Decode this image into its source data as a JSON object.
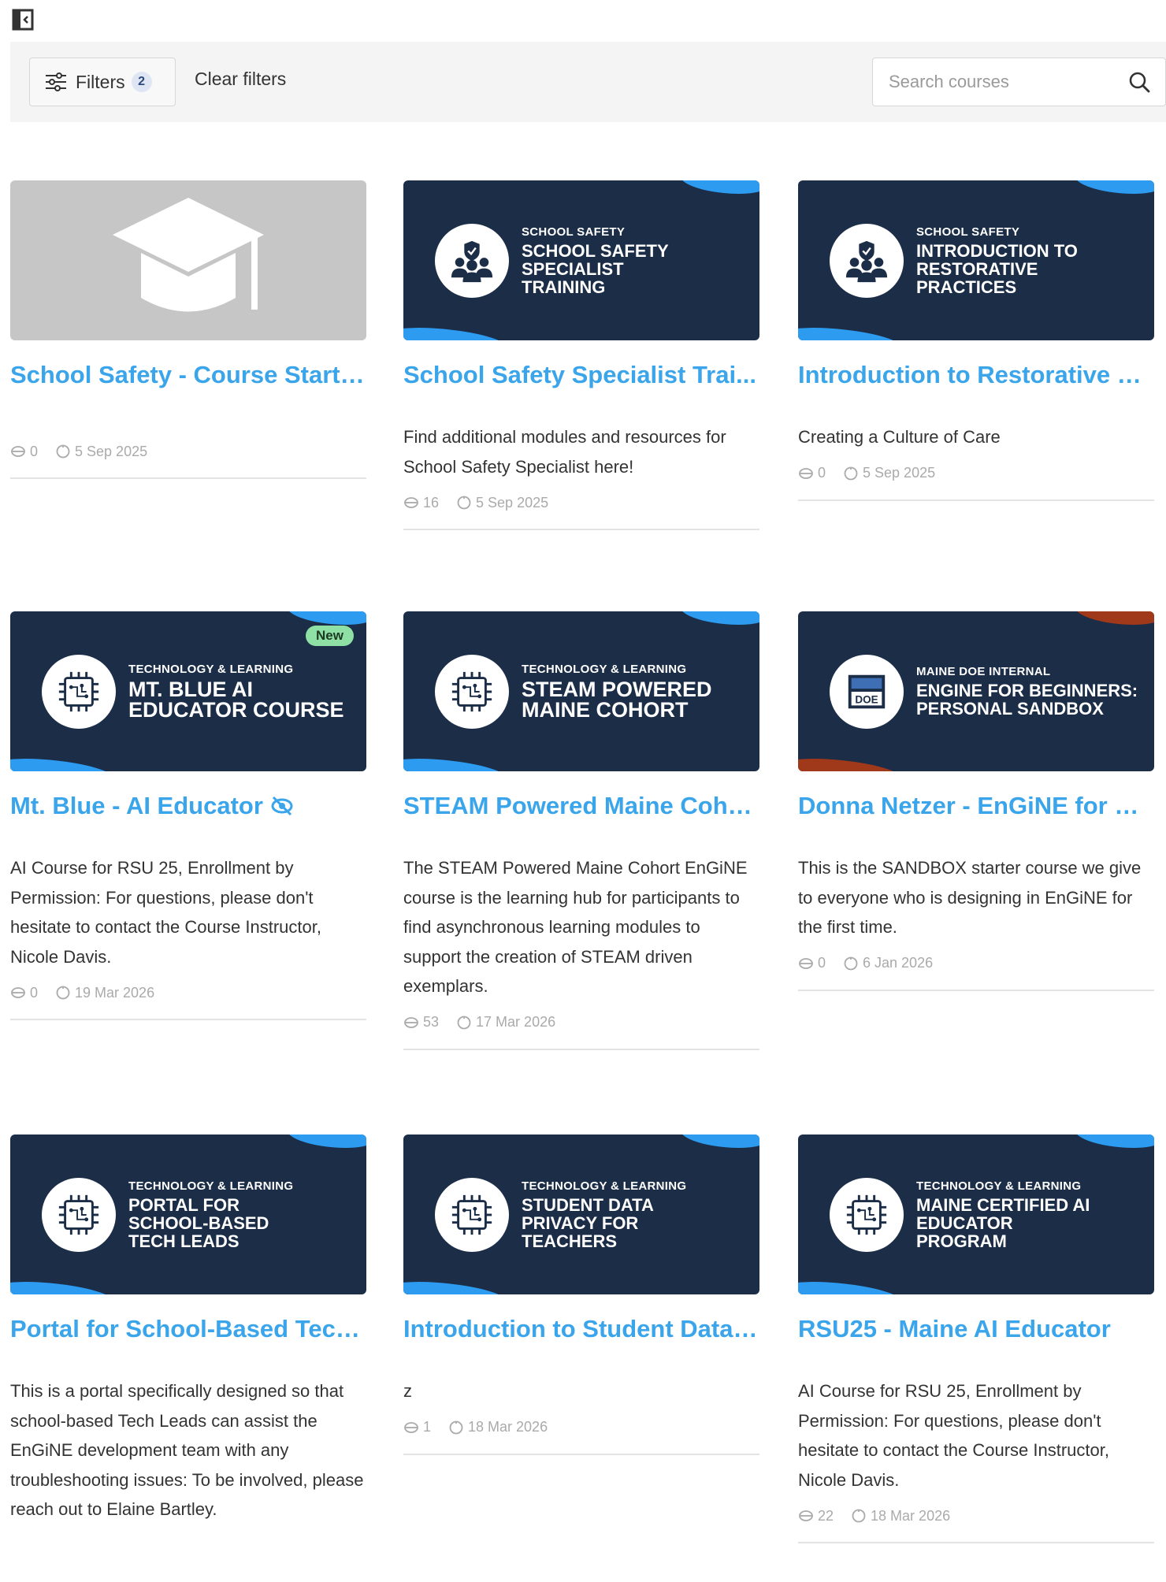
{
  "toolbar": {
    "filters_label": "Filters",
    "filters_count": "2",
    "clear_filters": "Clear filters",
    "search_placeholder": "Search courses"
  },
  "colors": {
    "accent": "#3aa5ea",
    "thumb_bg": "#1b2d47",
    "wave_blue": "#2d9bf0",
    "wave_rust": "#a0391a",
    "new_badge": "#8fe0a4"
  },
  "courses": [
    {
      "title": "School Safety - Course Starte...",
      "description": "",
      "enrolled": "0",
      "date": "5 Sep 2025",
      "thumb": {
        "type": "placeholder",
        "icon": "graduation-cap-icon"
      }
    },
    {
      "title": "School Safety Specialist Trai...",
      "description": "Find additional modules and resources for School Safety Specialist here!",
      "enrolled": "16",
      "date": "5 Sep 2025",
      "thumb": {
        "type": "banner",
        "category": "SCHOOL SAFETY",
        "heading": "SCHOOL SAFETY\nSPECIALIST\nTRAINING",
        "icon": "people-shield-icon"
      }
    },
    {
      "title": "Introduction to Restorative Pr...",
      "description": "Creating a Culture of Care",
      "enrolled": "0",
      "date": "5 Sep 2025",
      "thumb": {
        "type": "banner",
        "category": "SCHOOL SAFETY",
        "heading": "INTRODUCTION TO\nRESTORATIVE\nPRACTICES",
        "icon": "people-shield-icon"
      }
    },
    {
      "title": "Mt. Blue - AI Educator",
      "description": "AI Course for RSU 25, Enrollment by Permission: For questions, please don't hesitate to contact the Course Instructor, Nicole Davis.",
      "enrolled": "0",
      "date": "19 Mar 2026",
      "hidden": true,
      "badge": "New",
      "thumb": {
        "type": "banner",
        "category": "TECHNOLOGY & LEARNING",
        "heading": "MT. BLUE AI\nEDUCATOR COURSE",
        "icon": "chip-icon"
      }
    },
    {
      "title": "STEAM Powered Maine Cohort",
      "description": "The STEAM Powered Maine Cohort EnGiNE course is the learning hub for participants to find asynchronous learning modules to support the creation of STEAM driven exemplars.",
      "enrolled": "53",
      "date": "17 Mar 2026",
      "thumb": {
        "type": "banner",
        "category": "TECHNOLOGY & LEARNING",
        "heading": "STEAM POWERED\nMAINE COHORT",
        "icon": "chip-icon"
      }
    },
    {
      "title": "Donna Netzer - EnGiNE for Be...",
      "description": "This is the SANDBOX starter course we give to everyone who is designing in EnGiNE for the first time.",
      "enrolled": "0",
      "date": "6 Jan 2026",
      "thumb": {
        "type": "banner",
        "variant": "rust",
        "category": "MAINE DOE INTERNAL",
        "heading": "ENGINE FOR BEGINNERS:\nPERSONAL SANDBOX",
        "icon": "maine-doe-logo-icon"
      }
    },
    {
      "title": "Portal for School-Based Tech...",
      "description": "This is a portal specifically designed so that school-based Tech Leads can assist the EnGiNE development team with any troubleshooting issues: To be involved, please reach out to Elaine Bartley.",
      "enrolled": "",
      "date": "",
      "thumb": {
        "type": "banner",
        "category": "TECHNOLOGY & LEARNING",
        "heading": "PORTAL FOR\nSCHOOL-BASED\nTECH LEADS",
        "icon": "chip-icon"
      }
    },
    {
      "title": "Introduction to Student Data ...",
      "description": "z",
      "enrolled": "1",
      "date": "18 Mar 2026",
      "thumb": {
        "type": "banner",
        "category": "TECHNOLOGY & LEARNING",
        "heading": "STUDENT DATA\nPRIVACY FOR\nTEACHERS",
        "icon": "chip-icon"
      }
    },
    {
      "title": "RSU25 - Maine AI Educator",
      "description": "AI Course for RSU 25, Enrollment by Permission: For questions, please don't hesitate to contact the Course Instructor, Nicole Davis.",
      "enrolled": "22",
      "date": "18 Mar 2026",
      "thumb": {
        "type": "banner",
        "category": "TECHNOLOGY & LEARNING",
        "heading": "MAINE CERTIFIED AI\nEDUCATOR\nPROGRAM",
        "icon": "chip-icon"
      }
    }
  ]
}
